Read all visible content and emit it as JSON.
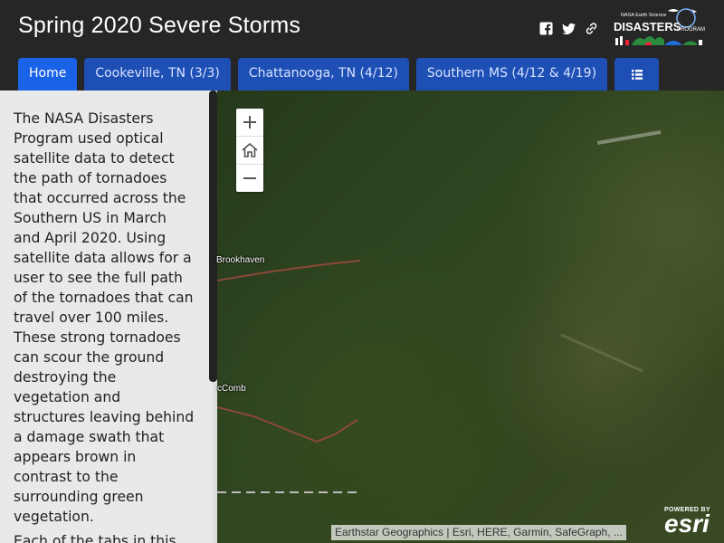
{
  "header": {
    "title": "Spring 2020 Severe Storms",
    "social": [
      "facebook-icon",
      "twitter-icon",
      "link-icon"
    ]
  },
  "logo": {
    "line1": "NASA Earth Science",
    "line2": "DISASTERS",
    "line3": "PROGRAM"
  },
  "tabs": [
    {
      "label": "Home",
      "active": true
    },
    {
      "label": "Cookeville, TN (3/3)",
      "active": false
    },
    {
      "label": "Chattanooga, TN (4/12)",
      "active": false
    },
    {
      "label": "Southern MS (4/12 & 4/19)",
      "active": false
    },
    {
      "label": "",
      "icon": "list-icon"
    }
  ],
  "sidebar": {
    "paragraph1": "The NASA Disasters Program used optical satellite data to detect the path of tornadoes that occurred across the Southern US in March and April 2020. Using satellite data allows for a user to see the full path of the tornadoes that can travel over 100 miles. These strong tornadoes can scour the ground destroying the vegetation and structures leaving behind a damage swath that appears brown in contrast to the surrounding green vegetation.",
    "paragraph2": "Each of the tabs in this"
  },
  "map": {
    "places": [
      "Brookhaven",
      "cComb"
    ],
    "attribution": "Earthstar Geographics | Esri, HERE, Garmin, SafeGraph, ...",
    "powered_by": "POWERED BY",
    "esri": "esri"
  },
  "colors": {
    "header_bg": "#262626",
    "tab_bg": "#1e4fb4",
    "tab_active": "#1a62e8",
    "sidebar_bg": "#e9e9e9"
  }
}
